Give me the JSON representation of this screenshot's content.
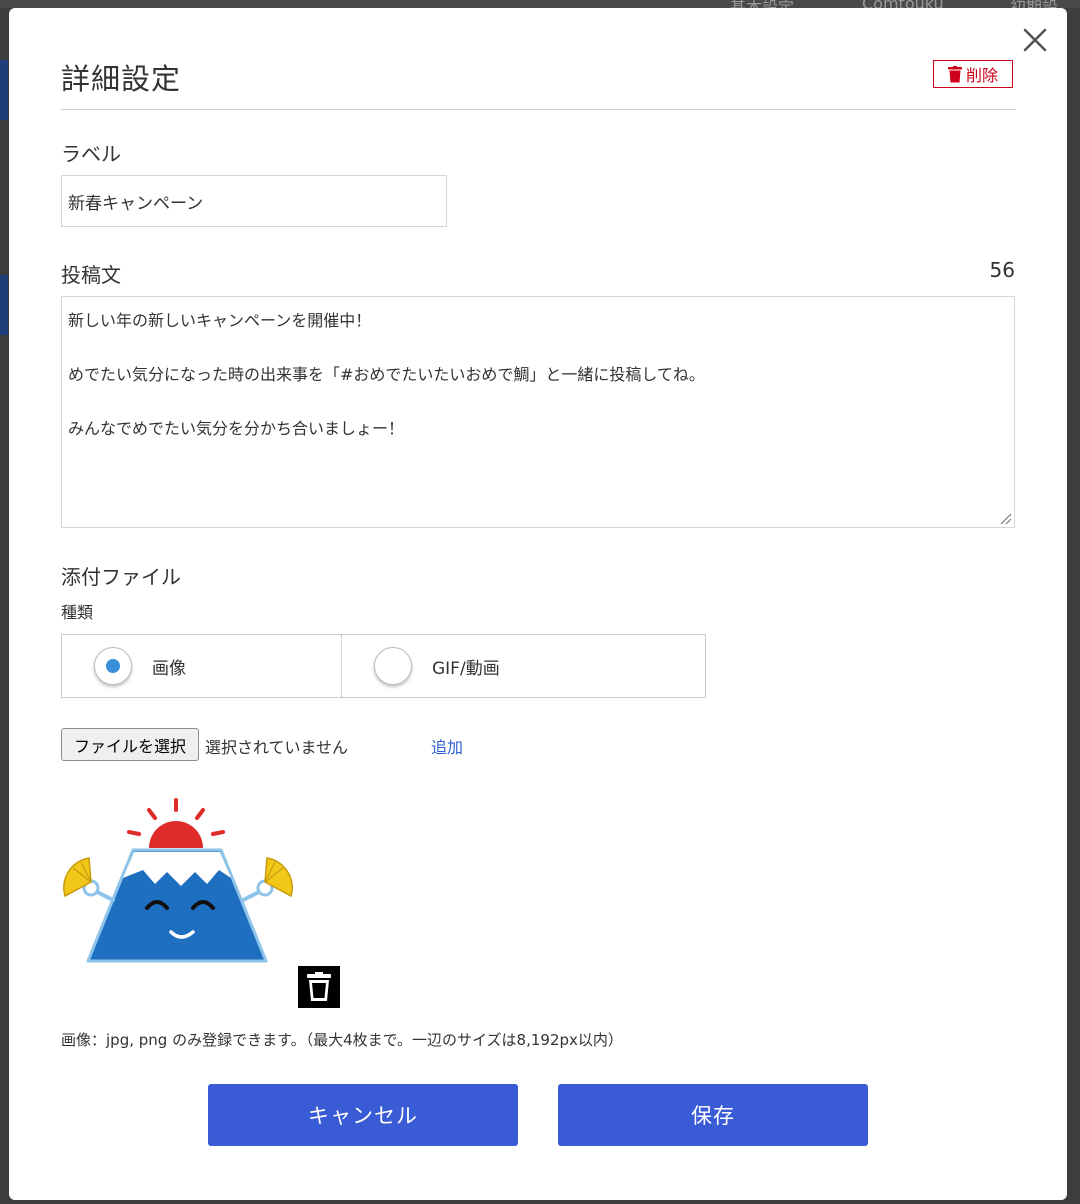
{
  "background": {
    "text_a": "基本設定",
    "text_b": "Comtouku",
    "text_c": "初期設"
  },
  "modal": {
    "title": "詳細設定",
    "delete_label": "削除",
    "label_section": {
      "heading": "ラベル",
      "value": "新春キャンペーン"
    },
    "post_section": {
      "heading": "投稿文",
      "char_count": "56",
      "lines": [
        "新しい年の新しいキャンペーンを開催中！",
        "",
        "めでたい気分になった時の出来事を「#おめでたいたいおめで鯛」と一緒に投稿してね。",
        "",
        "みんなでめでたい気分を分かち合いましょー！"
      ]
    },
    "attachment_section": {
      "heading": "添付ファイル",
      "type_label": "種類",
      "options": [
        {
          "label": "画像",
          "checked": true
        },
        {
          "label": "GIF/動画",
          "checked": false
        }
      ],
      "file_button": "ファイルを選択",
      "file_status": "選択されていません",
      "add_link": "追加",
      "note": "画像：jpg, png のみ登録できます。（最大4枚まで。一辺のサイズは8,192px以内）"
    },
    "buttons": {
      "cancel": "キャンセル",
      "save": "保存"
    }
  },
  "colors": {
    "primary": "#3a5bd6",
    "danger": "#d0021b",
    "link": "#2f5fd0",
    "radio_checked": "#3b8fd9"
  },
  "icons": {
    "close": "close-icon",
    "delete": "trash-icon",
    "image_delete": "trash-icon"
  }
}
